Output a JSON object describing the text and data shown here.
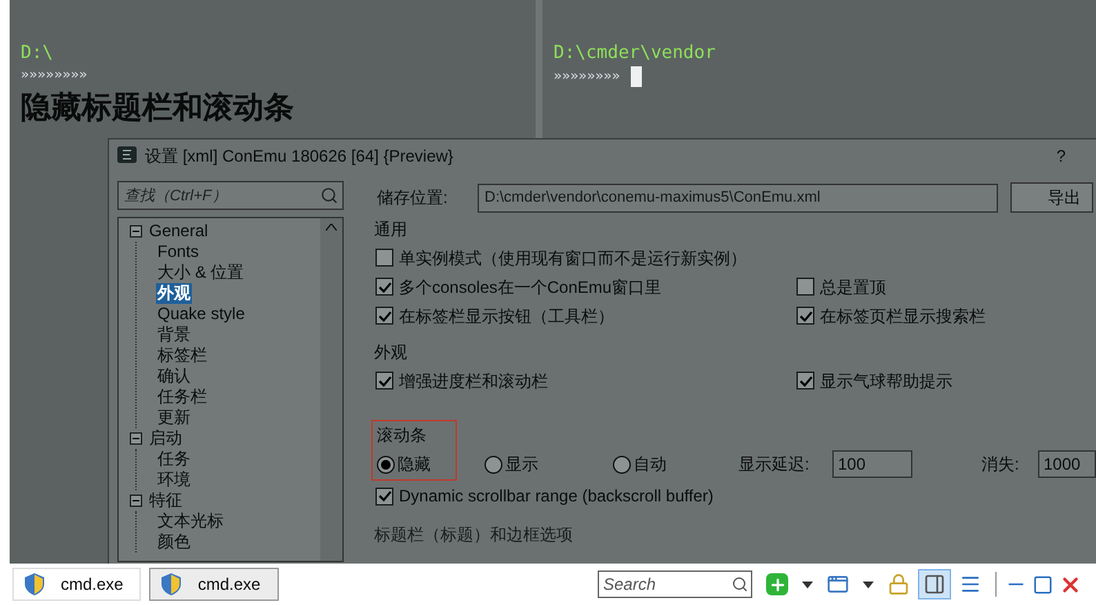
{
  "heading": "隐藏标题栏和滚动条",
  "terminal": {
    "panes": [
      {
        "path": "D:\\",
        "prompt": "»»»»»»»»",
        "cursor": false
      },
      {
        "path": "D:\\cmder\\vendor",
        "prompt": "»»»»»»»»",
        "cursor": true
      }
    ]
  },
  "settings_dialog": {
    "title": "设置 [xml] ConEmu 180626 [64] {Preview}",
    "help": "?",
    "search": {
      "placeholder": "查找（Ctrl+F）"
    },
    "tree": [
      {
        "label": "General",
        "expanded": true,
        "selected": false,
        "children": [
          {
            "label": "Fonts",
            "selected": false
          },
          {
            "label": "大小 & 位置",
            "selected": false
          },
          {
            "label": "外观",
            "selected": true
          },
          {
            "label": "Quake style",
            "selected": false
          },
          {
            "label": "背景",
            "selected": false
          },
          {
            "label": "标签栏",
            "selected": false
          },
          {
            "label": "确认",
            "selected": false
          },
          {
            "label": "任务栏",
            "selected": false
          },
          {
            "label": "更新",
            "selected": false
          }
        ]
      },
      {
        "label": "启动",
        "expanded": true,
        "selected": false,
        "children": [
          {
            "label": "任务",
            "selected": false
          },
          {
            "label": "环境",
            "selected": false
          }
        ]
      },
      {
        "label": "特征",
        "expanded": true,
        "selected": false,
        "children": [
          {
            "label": "文本光标",
            "selected": false
          },
          {
            "label": "颜色",
            "selected": false
          }
        ]
      }
    ],
    "storage": {
      "label": "储存位置:",
      "value": "D:\\cmder\\vendor\\conemu-maximus5\\ConEmu.xml",
      "button": "导出"
    },
    "groups": [
      {
        "title": "通用",
        "rows": [
          [
            {
              "label": "单实例模式（使用现有窗口而不是运行新实例）",
              "checked": false
            }
          ],
          [
            {
              "label": "多个consoles在一个ConEmu窗口里",
              "checked": true
            },
            {
              "label": "总是置顶",
              "checked": false
            }
          ],
          [
            {
              "label": "在标签栏显示按钮（工具栏）",
              "checked": true
            },
            {
              "label": "在标签页栏显示搜索栏",
              "checked": true
            }
          ]
        ]
      },
      {
        "title": "外观",
        "rows": [
          [
            {
              "label": "增强进度栏和滚动栏",
              "checked": true
            },
            {
              "label": "显示气球帮助提示",
              "checked": true
            }
          ]
        ]
      }
    ],
    "scrollbar": {
      "title": "滚动条",
      "options": [
        {
          "label": "隐藏",
          "selected": true
        },
        {
          "label": "显示",
          "selected": false
        },
        {
          "label": "自动",
          "selected": false
        }
      ],
      "delay": {
        "label": "显示延迟:",
        "value": "100"
      },
      "hide": {
        "label": "消失:",
        "value": "1000"
      },
      "dynamic": {
        "label": "Dynamic scrollbar range (backscroll buffer)",
        "checked": true
      }
    },
    "next_group_title": "标题栏（标题）和边框选项"
  },
  "tab_bar": {
    "tabs": [
      {
        "label": "cmd.exe",
        "selected": false
      },
      {
        "label": "cmd.exe",
        "selected": true
      }
    ],
    "search": {
      "placeholder": "Search"
    },
    "tools": [
      {
        "kind": "add",
        "selected": false
      },
      {
        "kind": "dropdown",
        "selected": false
      },
      {
        "kind": "window",
        "selected": false
      },
      {
        "kind": "dropdown",
        "selected": false
      },
      {
        "kind": "lock",
        "selected": false
      },
      {
        "kind": "split",
        "selected": true
      },
      {
        "kind": "list",
        "selected": false
      }
    ]
  }
}
